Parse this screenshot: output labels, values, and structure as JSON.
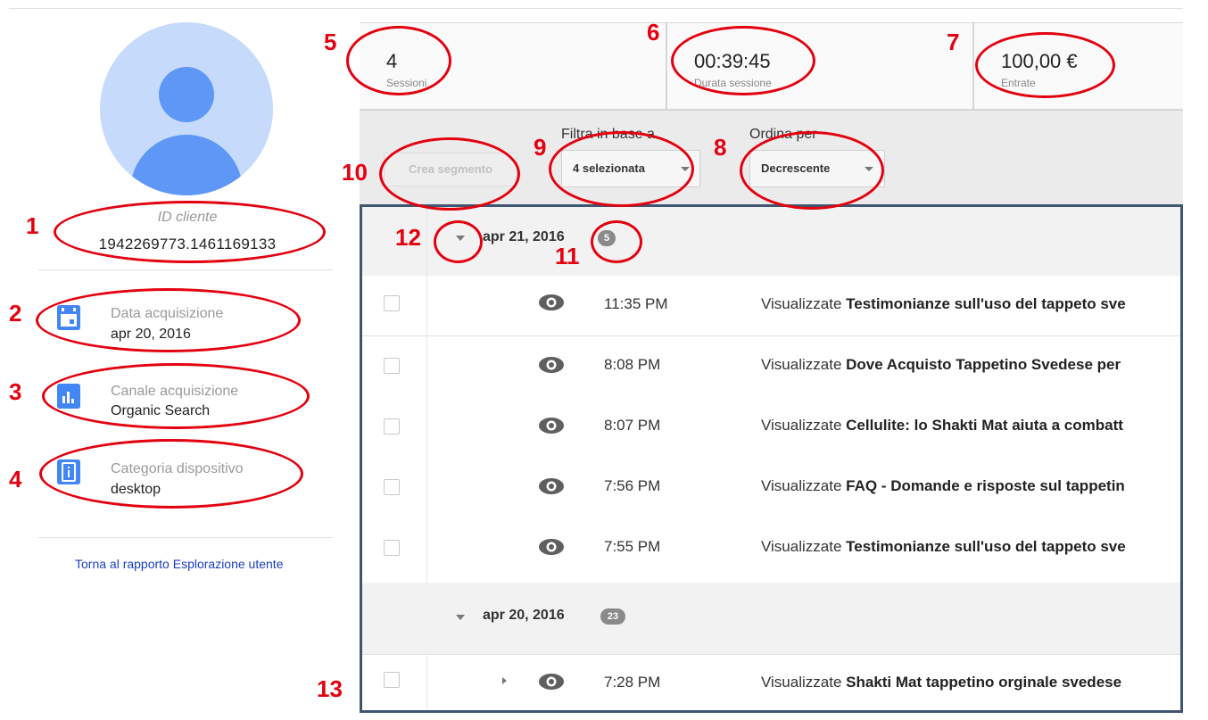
{
  "profile": {
    "client_id_label": "ID cliente",
    "client_id": "1942269773.1461169133",
    "acquisition_date_label": "Data acquisizione",
    "acquisition_date": "apr 20, 2016",
    "acquisition_channel_label": "Canale acquisizione",
    "acquisition_channel": "Organic Search",
    "device_category_label": "Categoria dispositivo",
    "device_category": "desktop",
    "back_link": "Torna al rapporto Esplorazione utente"
  },
  "metrics": [
    {
      "value": "4",
      "label": "Sessioni"
    },
    {
      "value": "00:39:45",
      "label": "Durata sessione"
    },
    {
      "value": "100,00 €",
      "label": "Entrate"
    }
  ],
  "filters": {
    "create_segment": "Crea segmento",
    "filter_label": "Filtra in base a",
    "filter_value": "4 selezionata",
    "sort_label": "Ordina per",
    "sort_value": "Decrescente"
  },
  "groups": [
    {
      "date": "apr 21, 2016",
      "count": "5",
      "activities": [
        {
          "time": "11:35 PM",
          "prefix": "Visualizzate",
          "title": "Testimonianze sull'uso del tappeto sve"
        },
        {
          "time": "8:08 PM",
          "prefix": "Visualizzate",
          "title": "Dove Acquisto Tappetino Svedese per"
        },
        {
          "time": "8:07 PM",
          "prefix": "Visualizzate",
          "title": "Cellulite: lo Shakti Mat aiuta a combatt"
        },
        {
          "time": "7:56 PM",
          "prefix": "Visualizzate",
          "title": "FAQ - Domande e risposte sul tappetin"
        },
        {
          "time": "7:55 PM",
          "prefix": "Visualizzate",
          "title": "Testimonianze sull'uso del tappeto sve"
        }
      ]
    },
    {
      "date": "apr 20, 2016",
      "count": "23",
      "activities": [
        {
          "time": "7:28 PM",
          "prefix": "Visualizzate",
          "title": "Shakti Mat tappetino orginale svedese"
        }
      ]
    }
  ],
  "annotations": [
    "1",
    "2",
    "3",
    "4",
    "5",
    "6",
    "7",
    "8",
    "9",
    "10",
    "11",
    "12",
    "13"
  ],
  "colors": {
    "annotation": "#e3000f",
    "accent": "#4285f4",
    "frame": "#3f5673"
  }
}
